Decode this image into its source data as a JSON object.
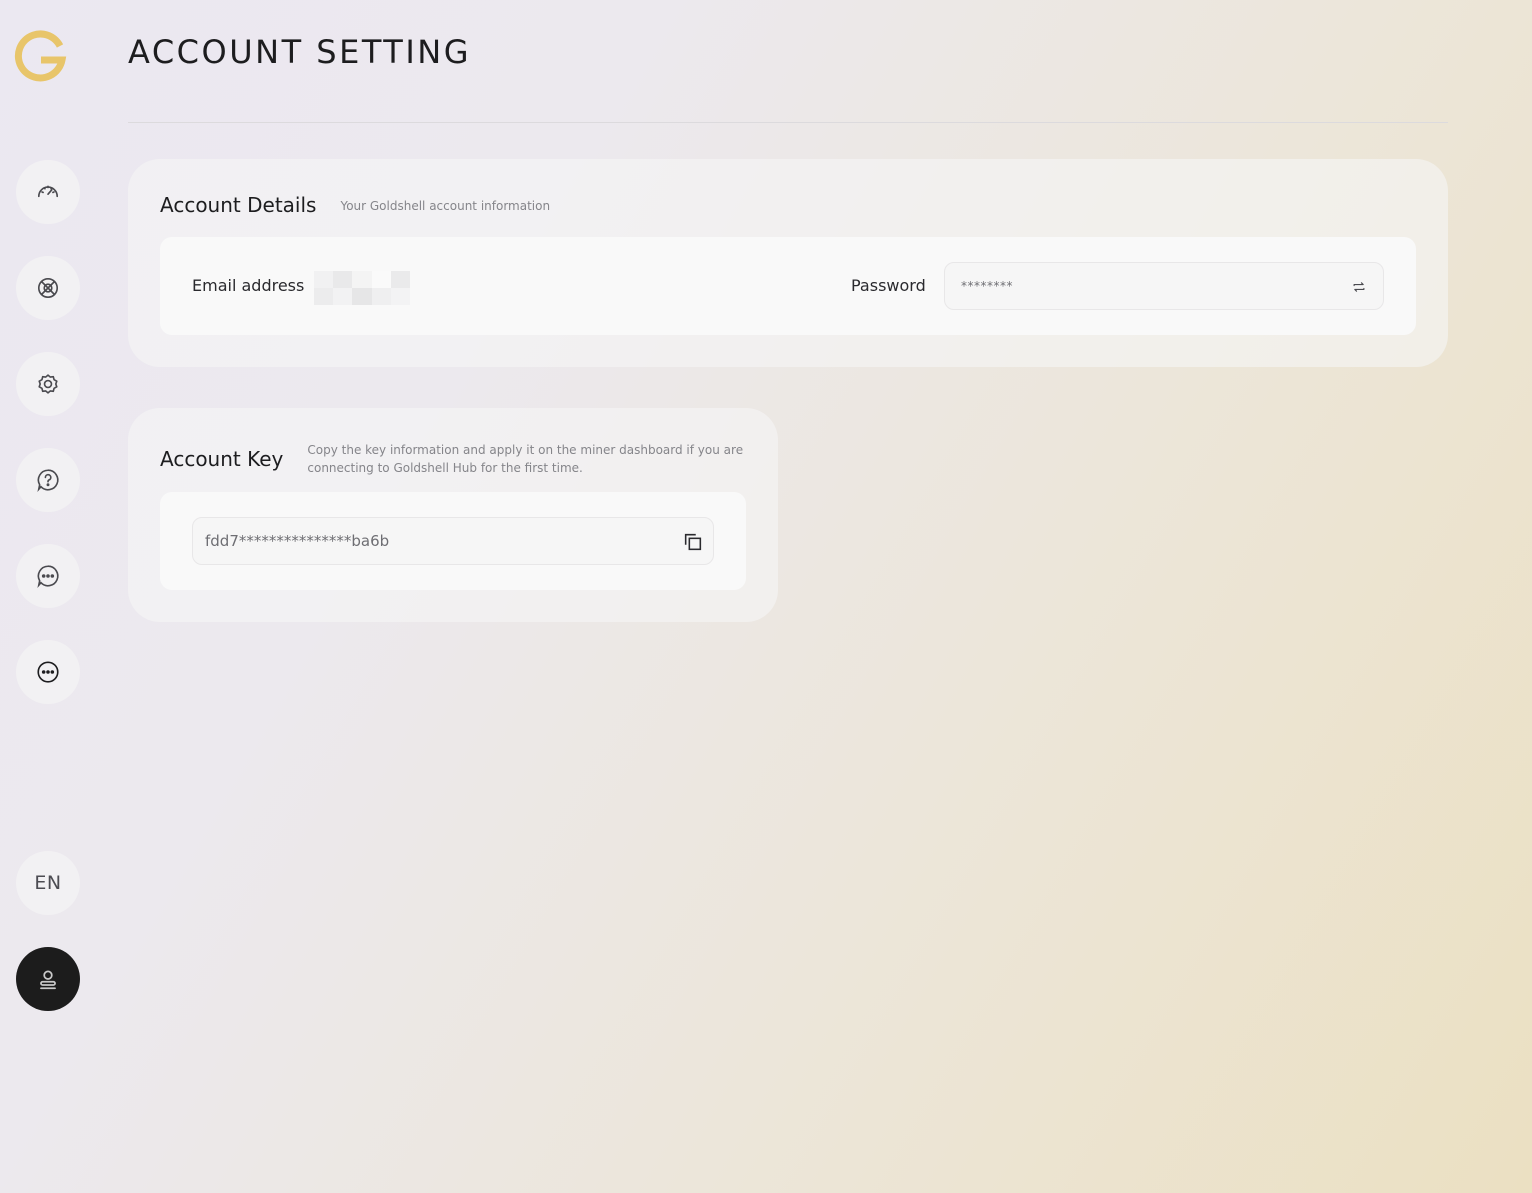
{
  "app": {
    "logo_icon": "goldshell-logo",
    "accent_color": "#e8c56a"
  },
  "sidebar": {
    "items": [
      {
        "icon": "dashboard-gauge-icon",
        "label": ""
      },
      {
        "icon": "miner-network-icon",
        "label": ""
      },
      {
        "icon": "settings-gear-icon",
        "label": ""
      },
      {
        "icon": "help-question-icon",
        "label": ""
      },
      {
        "icon": "chat-message-icon",
        "label": ""
      },
      {
        "icon": "more-dots-icon",
        "label": ""
      }
    ],
    "language": "EN",
    "profile_icon": "user-profile-icon"
  },
  "page": {
    "title": "ACCOUNT SETTING"
  },
  "account_details": {
    "title": "Account Details",
    "subtitle": "Your Goldshell account information",
    "email_label": "Email address",
    "email_value": "",
    "password_label": "Password",
    "password_value": "********",
    "password_action_icon": "refresh-swap-icon"
  },
  "account_key": {
    "title": "Account Key",
    "subtitle_line1": "Copy the key information and apply it on the miner dashboard if you are",
    "subtitle_line2": "connecting to Goldshell Hub for the first time.",
    "key_value": "fdd7***************ba6b",
    "copy_icon": "copy-icon"
  }
}
